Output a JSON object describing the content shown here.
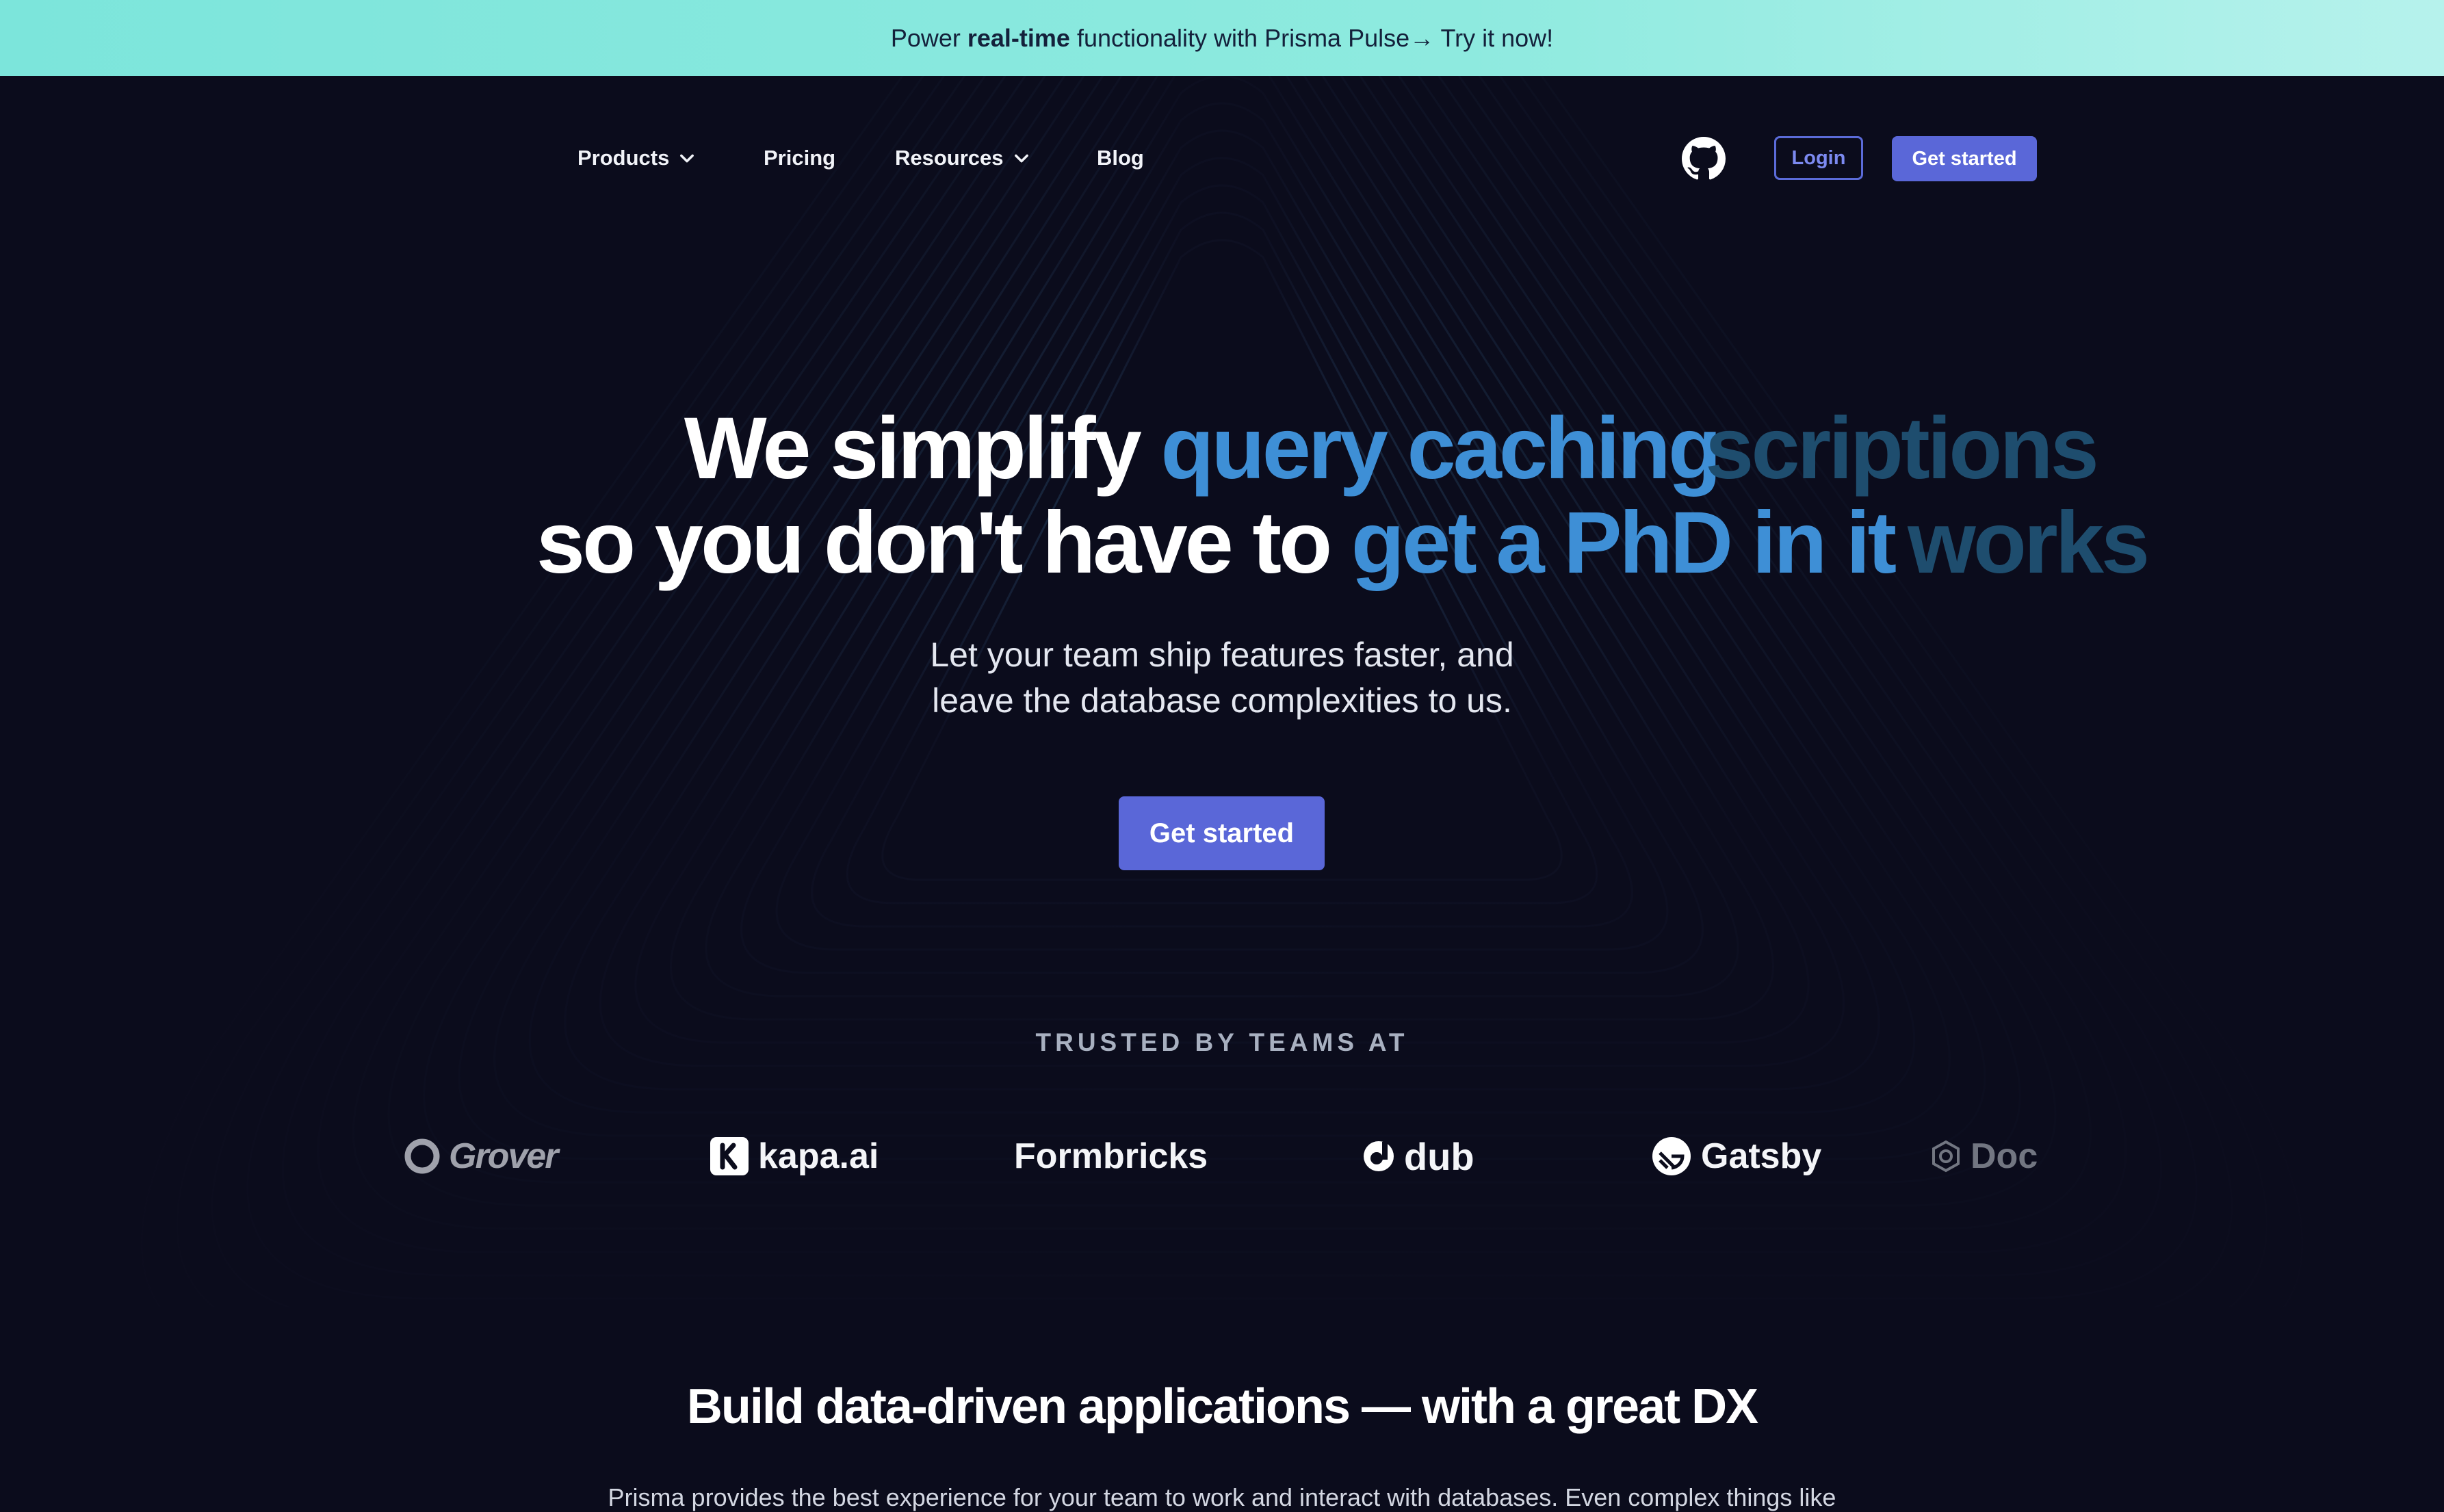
{
  "banner": {
    "prefix": "Power ",
    "bold": "real-time",
    "suffix": " functionality with Prisma Pulse→ Try it now!"
  },
  "nav": {
    "items": [
      {
        "label": "Products",
        "dropdown": true
      },
      {
        "label": "Pricing",
        "dropdown": false
      },
      {
        "label": "Resources",
        "dropdown": true
      },
      {
        "label": "Blog",
        "dropdown": false
      }
    ],
    "github_icon": "github-icon",
    "login_label": "Login",
    "get_started_label": "Get started"
  },
  "hero": {
    "line1_static": "We simplify ",
    "line1_highlight": "query caching",
    "line1_ghost": "scriptions",
    "line2_static": "so you don't have to ",
    "line2_highlight": "get a PhD in it",
    "line2_ghost": "works",
    "subtitle_line1": "Let your team ship features faster, and",
    "subtitle_line2": "leave the database complexities to us.",
    "cta_label": "Get started"
  },
  "trusted": {
    "heading": "TRUSTED BY TEAMS AT",
    "logos": [
      "Grover",
      "kapa.ai",
      "Formbricks",
      "dub",
      "Gatsby",
      "Doc"
    ]
  },
  "section": {
    "title": "Build data-driven applications — with a great DX",
    "paragraph": "Prisma provides the best experience for your team to work and interact with databases. Even complex things like"
  },
  "colors": {
    "background": "#0b0c1c",
    "accent": "#5a67d8",
    "highlight": "#3e8fd6",
    "banner": "#7ce5db"
  }
}
